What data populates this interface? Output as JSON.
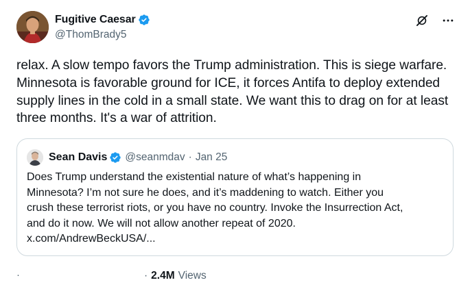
{
  "author": {
    "display_name": "Fugitive Caesar",
    "handle": "@ThomBrady5"
  },
  "tweet": {
    "text": "relax. A slow tempo favors the Trump administration. This is siege warfare. Minnesota is favorable ground for ICE, it forces Antifa to deploy extended supply lines in the cold in a small state. We want this to drag on for at least three months. It's a war of attrition."
  },
  "quote": {
    "display_name": "Sean Davis",
    "handle": "@seanmdav",
    "separator": "·",
    "date": "Jan 25",
    "text_lines": [
      "Does Trump understand the existential nature of what’s happening in",
      "Minnesota? I’m not sure he does, and it’s maddening to watch. Either you",
      "crush these terrorist riots, or you have no country. Invoke the Insurrection Act,",
      "and do it now. We will not allow another repeat of 2020.",
      "x.com/AndrewBeckUSA/..."
    ]
  },
  "meta": {
    "left_dot": "·",
    "separator": "·",
    "views_count": "2.4M",
    "views_label": "Views"
  },
  "icons": {
    "verified": "verified-badge-icon",
    "grok": "grok-icon",
    "more": "more-horizontal-icon"
  },
  "colors": {
    "verified_blue": "#1d9bf0",
    "secondary_text": "#536471",
    "border": "#cfd9de"
  }
}
